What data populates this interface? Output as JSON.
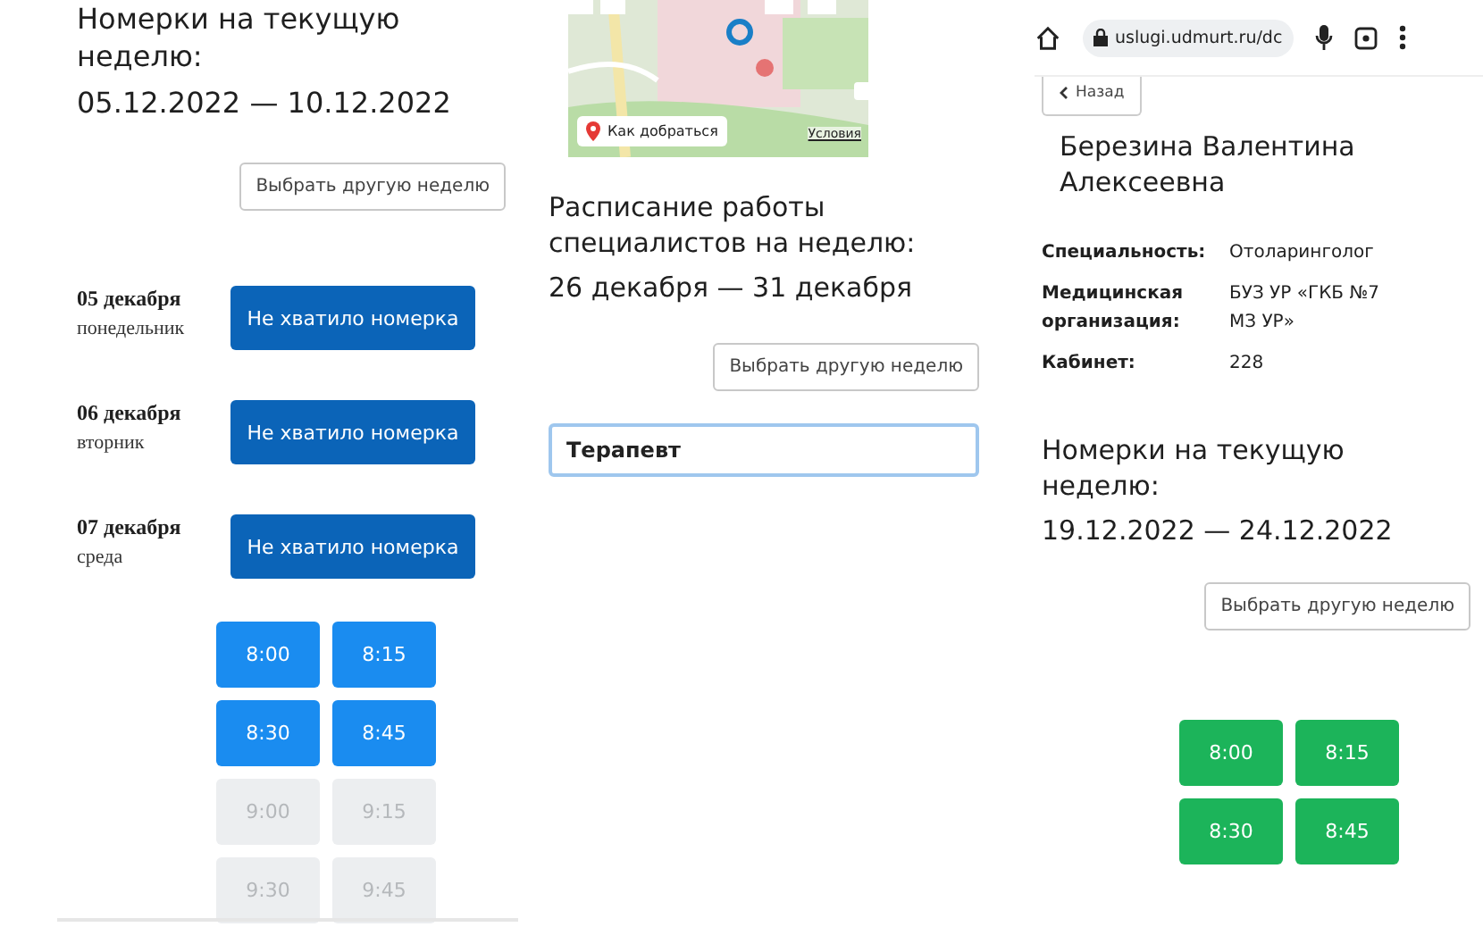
{
  "panel_1": {
    "heading": "Номерки на текущую неделю:",
    "dates": "05.12.2022 — 10.12.2022",
    "week_button": "Выбрать другую неделю",
    "days": [
      {
        "date": "05 декабря",
        "weekday": "понедельник",
        "status": "Не хватило номерка"
      },
      {
        "date": "06 декабря",
        "weekday": "вторник",
        "status": "Не хватило номерка"
      },
      {
        "date": "07 декабря",
        "weekday": "среда",
        "status": "Не хватило номерка"
      }
    ],
    "slots": [
      {
        "time": "8:00",
        "disabled": false
      },
      {
        "time": "8:15",
        "disabled": false
      },
      {
        "time": "8:30",
        "disabled": false
      },
      {
        "time": "8:45",
        "disabled": false
      },
      {
        "time": "9:00",
        "disabled": true
      },
      {
        "time": "9:15",
        "disabled": true
      },
      {
        "time": "9:30",
        "disabled": true
      },
      {
        "time": "9:45",
        "disabled": true
      }
    ]
  },
  "panel_2": {
    "map": {
      "kind": "picture",
      "route_button": "Как добраться",
      "terms_link": "Условия"
    },
    "heading": "Расписание работы специалистов на неделю:",
    "dates": "26 декабря — 31 декабря",
    "week_button": "Выбрать другую неделю",
    "specialty_field": {
      "value": "Терапевт"
    }
  },
  "panel_3": {
    "browser": {
      "url": "uslugi.udmurt.ru/dc"
    },
    "back_button": "Назад",
    "doctor_name": "Березина Валентина Алексеевна",
    "details": [
      {
        "label": "Специальность:",
        "value": "Отоларинголог"
      },
      {
        "label": "Медицинская организация:",
        "value": "БУЗ УР «ГКБ №7 МЗ УР»"
      },
      {
        "label": "Кабинет:",
        "value": "228"
      }
    ],
    "heading": "Номерки на текущую неделю:",
    "dates": "19.12.2022 — 24.12.2022",
    "week_button": "Выбрать другую неделю",
    "slots": [
      {
        "time": "8:00",
        "disabled": false
      },
      {
        "time": "8:15",
        "disabled": false
      },
      {
        "time": "8:30",
        "disabled": false
      },
      {
        "time": "8:45",
        "disabled": false
      }
    ]
  }
}
